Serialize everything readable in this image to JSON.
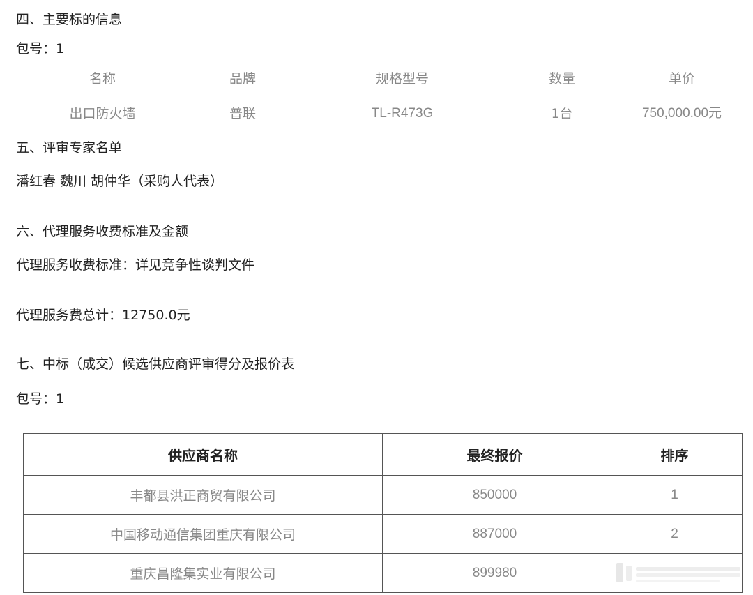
{
  "section4": {
    "heading": "四、主要标的信息",
    "package": "包号：1",
    "columns": [
      "名称",
      "品牌",
      "规格型号",
      "数量",
      "单价"
    ],
    "row": [
      "出口防火墙",
      "普联",
      "TL-R473G",
      "1台",
      "750,000.00元"
    ]
  },
  "section5": {
    "heading": "五、评审专家名单",
    "experts": "潘红春 魏川 胡仲华（采购人代表）"
  },
  "section6": {
    "heading": "六、代理服务收费标准及金额",
    "standard": "代理服务收费标准：详见竞争性谈判文件",
    "total": "代理服务费总计：12750.0元"
  },
  "section7": {
    "heading": "七、中标（成交）候选供应商评审得分及报价表",
    "package": "包号：1",
    "table": {
      "headers": [
        "供应商名称",
        "最终报价",
        "排序"
      ],
      "rows": [
        [
          "丰都县洪正商贸有限公司",
          "850000",
          "1"
        ],
        [
          "中国移动通信集团重庆有限公司",
          "887000",
          "2"
        ],
        [
          "重庆昌隆集实业有限公司",
          "899980",
          ""
        ]
      ]
    }
  }
}
